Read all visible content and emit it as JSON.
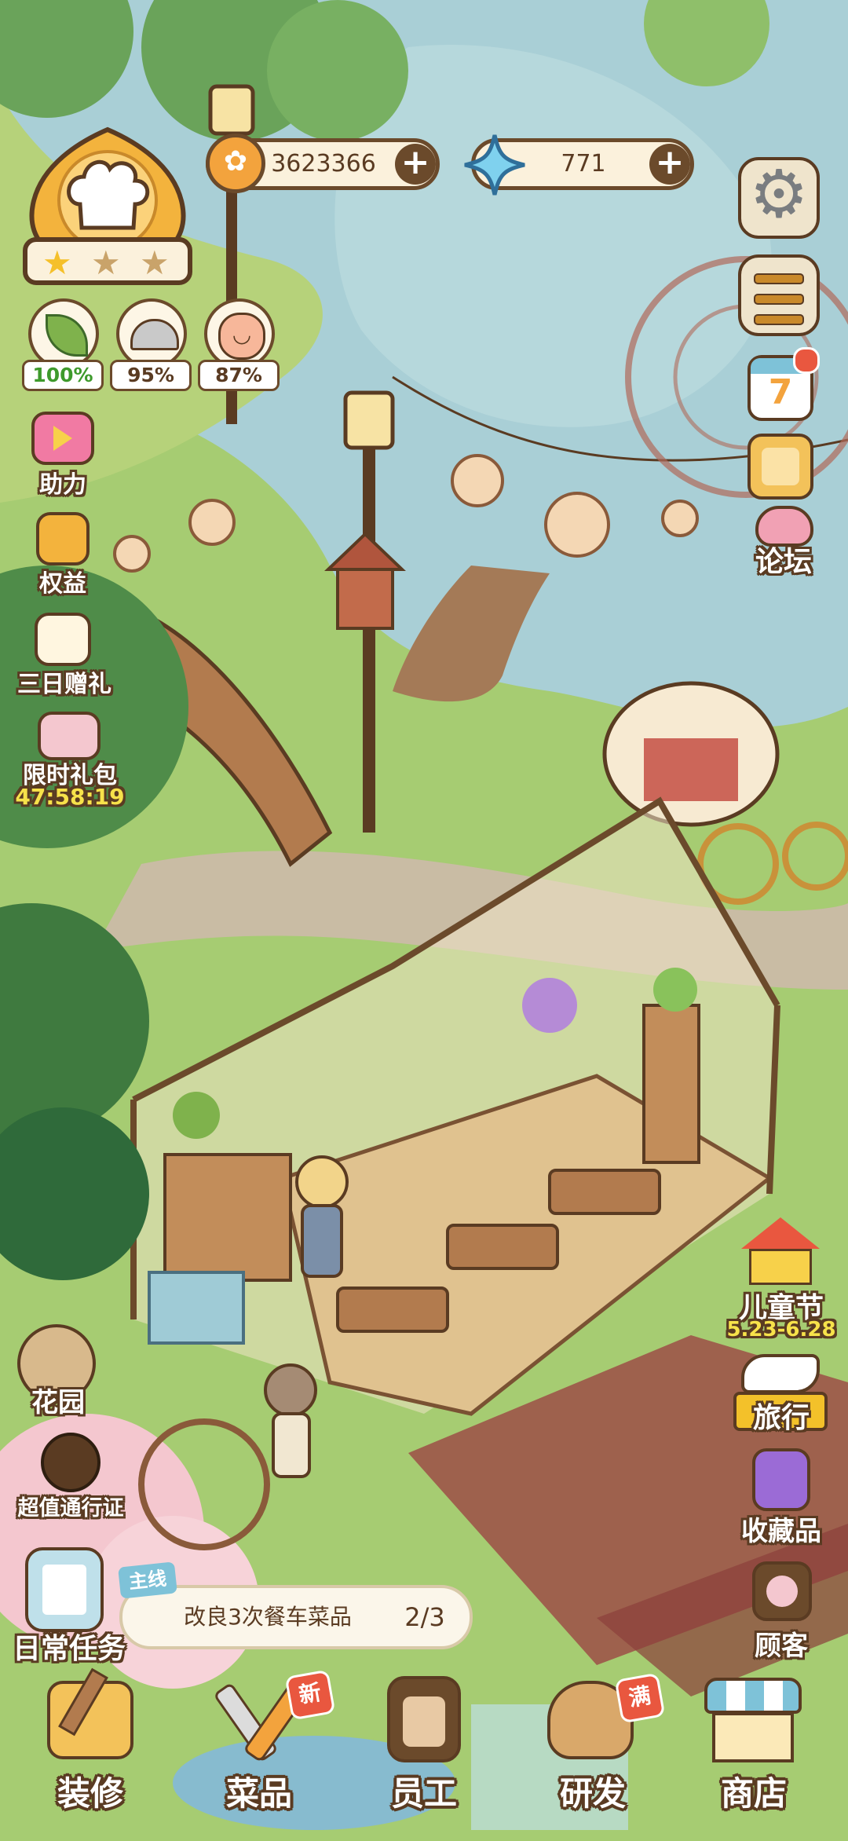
{
  "currency": {
    "coins": "3623366",
    "gems": "771"
  },
  "stats": [
    {
      "value": "100%",
      "color": "#3e9a2c",
      "icon": "leaf-icon"
    },
    {
      "value": "95%",
      "color": "#5a3b22",
      "icon": "cloche-icon"
    },
    {
      "value": "87%",
      "color": "#5a3b22",
      "icon": "smiley-icon"
    }
  ],
  "left_menu": {
    "support": "助力",
    "benefits": "权益",
    "three_day_gift": "三日赠礼",
    "limited_pack": "限时礼包",
    "limited_timer": "47:58:19",
    "garden": "花园",
    "pass": "超值通行证",
    "daily_tasks": "日常任务"
  },
  "right_menu": {
    "calendar_day": "7",
    "forum": "论坛",
    "childrens_day": "儿童节",
    "childrens_dates": "5.23-6.28",
    "travel": "旅行",
    "collection": "收藏品",
    "customers": "顾客"
  },
  "quest": {
    "tag": "主线",
    "text": "改良3次餐车菜品",
    "progress": "2/3"
  },
  "bottom_nav": {
    "decorate": "装修",
    "dishes": "菜品",
    "dishes_badge": "新",
    "staff": "员工",
    "research": "研发",
    "research_badge": "满",
    "shop": "商店"
  },
  "colors": {
    "outline": "#5a3b22",
    "cream": "#fbf1dc",
    "gold": "#f3b33d",
    "red_dot": "#e9573f"
  }
}
